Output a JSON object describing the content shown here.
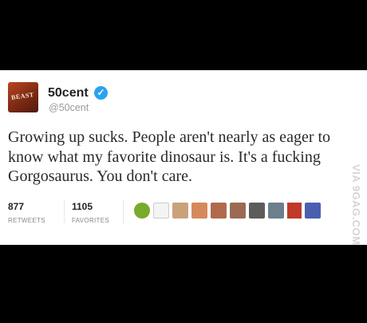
{
  "tweet": {
    "author_name": "50cent",
    "handle": "@50cent",
    "avatar_text": "BEAST",
    "text": "Growing up sucks. People aren't nearly as eager to\nknow what my favorite dinosaur is. It's a fucking\nGorgosaurus. You don't care.",
    "retweets_count": "877",
    "retweets_label": "RETWEETS",
    "favorites_count": "1105",
    "favorites_label": "FAVORITES",
    "verified_icon": "checkmark-badge-icon"
  },
  "watermark": "VIA 9GAG.COM"
}
